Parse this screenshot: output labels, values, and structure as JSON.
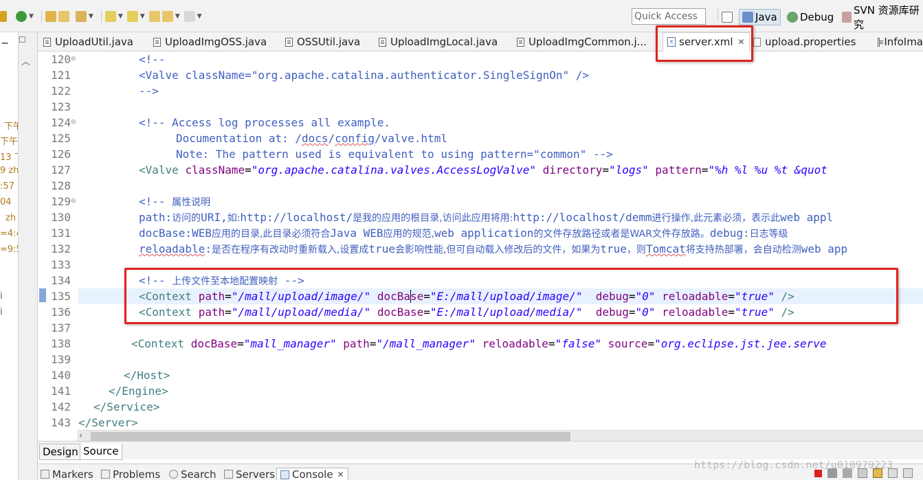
{
  "toolbar": {
    "quick_access_placeholder": "Quick Access",
    "perspectives": [
      {
        "label": "Java"
      },
      {
        "label": "Debug"
      },
      {
        "label": "SVN 资源库研究"
      }
    ]
  },
  "left_fragments": [
    "下午",
    "下午",
    "13 下",
    "9 zh",
    ":57",
    "04",
    "zh",
    "=4:4",
    "=9:5",
    "i",
    "i"
  ],
  "editor_tabs": [
    {
      "label": "UploadUtil.java"
    },
    {
      "label": "UploadImgOSS.java"
    },
    {
      "label": "OSSUtil.java"
    },
    {
      "label": "UploadImgLocal.java"
    },
    {
      "label": "UploadImgCommon.j..."
    },
    {
      "label": "server.xml"
    },
    {
      "label": "upload.properties"
    },
    {
      "label": "InfoIma"
    }
  ],
  "line_numbers": [
    "120",
    "121",
    "122",
    "123",
    "124",
    "125",
    "126",
    "127",
    "128",
    "129",
    "130",
    "131",
    "132",
    "133",
    "134",
    "135",
    "136",
    "137",
    "138",
    "139",
    "140",
    "141",
    "142",
    "143"
  ],
  "code": {
    "l120": "<!--",
    "l121_a": "<Valve className=\"org.apache.catalina.authenticator.SingleSignOn\" />",
    "l122": "-->",
    "l124_a": "<!-- ",
    "l124_b": "Access log processes all example.",
    "l125_a": "Documentation at: /",
    "l125_b": "docs",
    "l125_c": "/",
    "l125_d": "config",
    "l125_e": "/valve.html",
    "l126": "Note: The pattern used is equivalent to using pattern=\"common\" -->",
    "l127_tag": "<Valve",
    "l127_attr1": "className",
    "l127_val1": "\"org.apache.catalina.valves.AccessLogValve\"",
    "l127_attr2": "directory",
    "l127_val2": "\"logs\"",
    "l127_attr3": "pattern",
    "l127_val3": "\"%h %l %u %t &quot",
    "l129_a": "<!-- ",
    "l129_b": "属性说明",
    "l130_a": "path:",
    "l130_b": "访问的",
    "l130_c": "URI,",
    "l130_d": "如:",
    "l130_e": "http://localhost/",
    "l130_f": "是我的应用的根目录,访问此应用将用:",
    "l130_g": "http://localhost/demm",
    "l130_h": "进行操作,此元素必须，表示此",
    "l130_i": "web appl",
    "l131_a": "docBase:WEB",
    "l131_b": "应用的目录,此目录必须符合",
    "l131_c": "Java WEB",
    "l131_d": "应用的规范,",
    "l131_e": "web application",
    "l131_f": "的文件存放路径或者是",
    "l131_g": "WAR",
    "l131_h": "文件存放路。",
    "l131_i": "debug:",
    "l131_j": "日志等级",
    "l132_a": "reloadable",
    "l132_b": ":",
    "l132_c": "是否在程序有改动时重新载入,设置成",
    "l132_d": "true",
    "l132_e": "会影响性能,但可自动载入修改后的文件，如果为",
    "l132_f": "true",
    "l132_g": "，则",
    "l132_h": "Tomcat",
    "l132_i": "将支持热部署，会自动检测",
    "l132_j": "web app",
    "l134_a": "<!-- ",
    "l134_b": "上传文件至本地配置映射",
    "l134_c": " -->",
    "ctx_tag": "<Context",
    "ctx_path": "path",
    "ctx_docbase": "docBase",
    "ctx_debug": "debug",
    "ctx_reload": "reloadable",
    "ctx_close": " />",
    "l135_v1": "\"/mall/upload/image/\"",
    "l135_v2": "\"E:/mall/upload/image/\"",
    "l136_v1": "\"/mall/upload/media/\"",
    "l136_v2": "\"E:/mall/upload/media/\"",
    "v_debug": "\"0\"",
    "v_true": "\"true\"",
    "l138_v1": "\"mall_manager\"",
    "l138_v2": "\"/mall_manager\"",
    "l138_attr3": "reloadable",
    "l138_v3": "\"false\"",
    "l138_attr4": "source",
    "l138_v4": "\"org.eclipse.jst.jee.serve",
    "l140": "</Host>",
    "l141": "</Engine>",
    "l142": "</Service>",
    "l143": "</Server>"
  },
  "design_source_tabs": [
    "Design",
    "Source"
  ],
  "bottom_views": [
    "Markers",
    "Problems",
    "Search",
    "Servers",
    "Console"
  ],
  "watermark": "https://blog.csdn.net/u010979223",
  "colors": {
    "highlight": "#e0221c",
    "tag": "#3f7f7f",
    "attr": "#7f007f",
    "value": "#2a00ff",
    "comment": "#3f5fbf"
  }
}
